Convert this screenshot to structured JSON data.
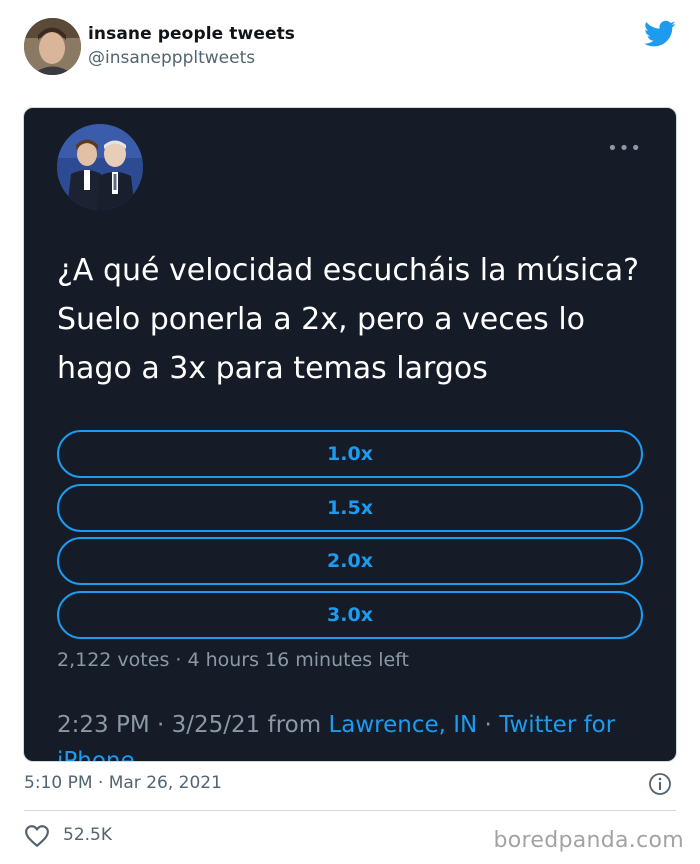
{
  "author": {
    "name": "insane people tweets",
    "handle": "@insanepppltweets"
  },
  "embedded_tweet": {
    "text": "¿A qué velocidad escucháis la música? Suelo ponerla a 2x, pero a veces lo hago a 3x para temas largos",
    "poll": {
      "options": [
        "1.0x",
        "1.5x",
        "2.0x",
        "3.0x"
      ],
      "meta": "2,122 votes · 4 hours 16 minutes left"
    },
    "meta": {
      "time": "2:23 PM · 3/25/21",
      "from": " from ",
      "location": "Lawrence, IN",
      "separator": " · ",
      "source": "Twitter for",
      "source_overflow": "iPhone"
    }
  },
  "timestamp": "5:10 PM · Mar 26, 2021",
  "likes": "52.5K",
  "watermark": "boredpanda.com",
  "colors": {
    "accent": "#1d9bf0",
    "embed_bg": "#151c28",
    "muted": "#536471"
  },
  "icons": {
    "brand": "twitter-bird-icon",
    "more": "more-dots-icon",
    "info": "info-icon",
    "like": "heart-icon"
  }
}
